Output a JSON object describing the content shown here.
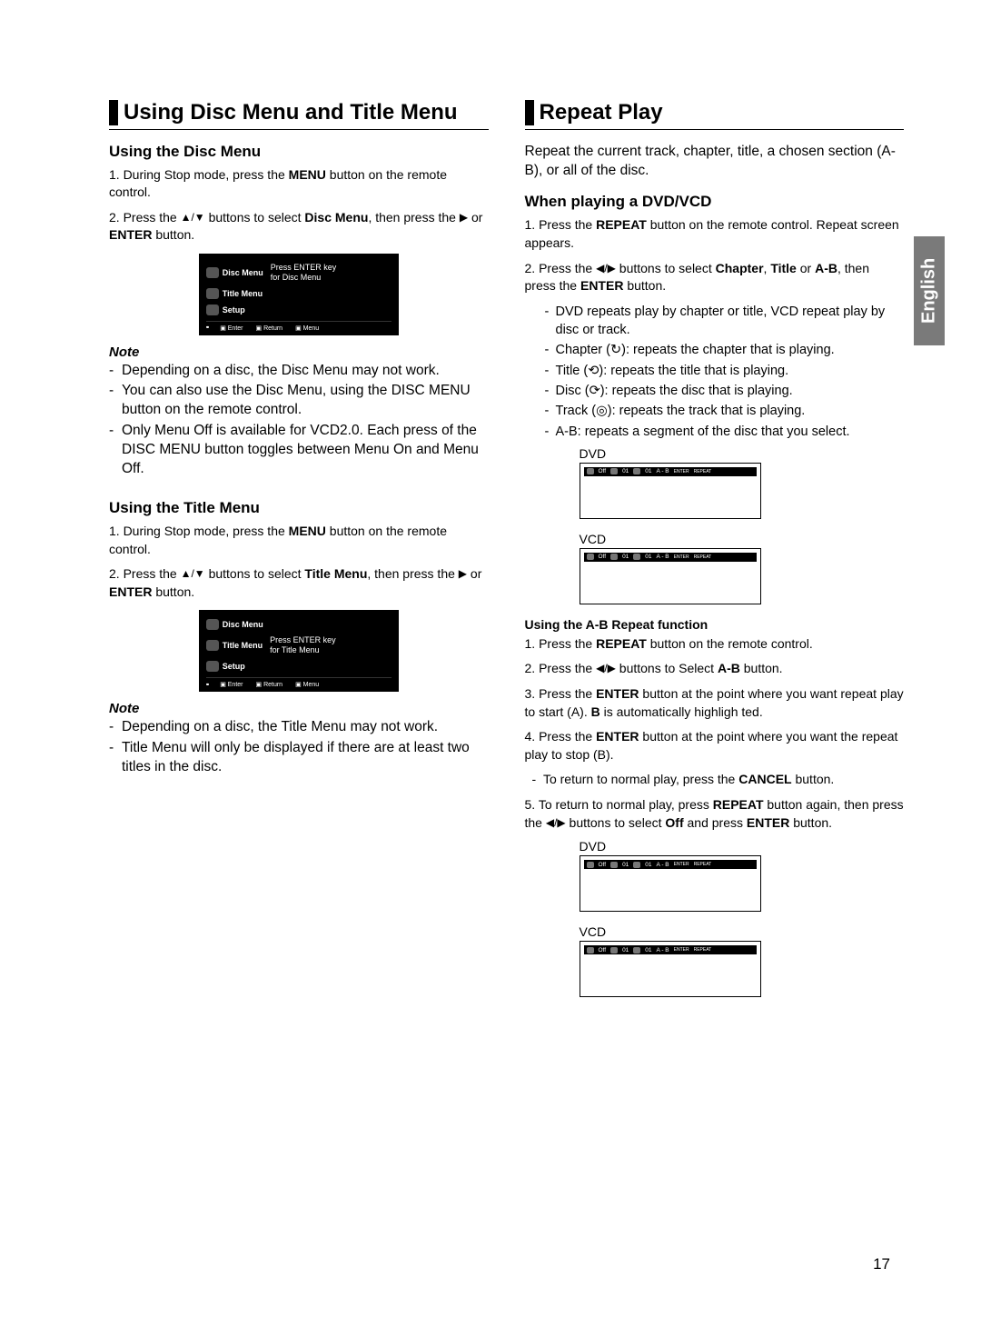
{
  "lang_tab": "English",
  "page_number": "17",
  "left": {
    "section_title": "Using Disc Menu and Title Menu",
    "disc": {
      "heading": "Using the Disc Menu",
      "step1_a": "1. During Stop mode, press the ",
      "step1_b": "MENU",
      "step1_c": " button on the remote control.",
      "step2_a": "2. Press the ",
      "step2_b": "▲/▼",
      "step2_c": " buttons to select ",
      "step2_d": "Disc Menu",
      "step2_e": ", then press the ",
      "step2_f": "▶",
      "step2_g": " or ",
      "step2_h": "ENTER",
      "step2_i": " button.",
      "osd": {
        "item1": "Disc Menu",
        "item2": "Title Menu",
        "item3": "Setup",
        "hint1": "Press ENTER key",
        "hint2": "for Disc Menu",
        "f1": "Enter",
        "f2": "Return",
        "f3": "Menu"
      },
      "note_label": "Note",
      "note1": "Depending on a disc, the Disc Menu may not work.",
      "note2": "You can also use the Disc Menu, using the DISC MENU button on the remote control.",
      "note3": "Only Menu Off is available for VCD2.0. Each press of the DISC MENU button toggles between Menu On and Menu Off."
    },
    "title": {
      "heading": "Using the Title Menu",
      "step1_a": "1. During Stop mode, press the ",
      "step1_b": "MENU",
      "step1_c": " button on the remote control.",
      "step2_a": "2. Press the ",
      "step2_b": "▲/▼",
      "step2_c": " buttons to select ",
      "step2_d": "Title Menu",
      "step2_e": ", then press the ",
      "step2_f": "▶",
      "step2_g": " or ",
      "step2_h": "ENTER",
      "step2_i": " button.",
      "osd": {
        "item1": "Disc Menu",
        "item2": "Title Menu",
        "item3": "Setup",
        "hint1": "Press ENTER key",
        "hint2": "for Title Menu",
        "f1": "Enter",
        "f2": "Return",
        "f3": "Menu"
      },
      "note_label": "Note",
      "note1": "Depending on a disc, the Title Menu may not work.",
      "note2": "Title Menu will only be displayed if there are at least two titles in the disc."
    }
  },
  "right": {
    "section_title": "Repeat Play",
    "intro": "Repeat the current track, chapter, title, a chosen section (A-B), or all of the disc.",
    "heading": "When playing a DVD/VCD",
    "step1_a": "1. Press the ",
    "step1_b": "REPEAT",
    "step1_c": " button on the remote control. Repeat screen appears.",
    "step2_a": "2. Press the ",
    "step2_b": "◀/▶",
    "step2_c": " buttons to select ",
    "step2_d": "Chapter",
    "step2_e": ", ",
    "step2_f": "Title",
    "step2_g": " or ",
    "step2_h": "A-B",
    "step2_i": ", then press the ",
    "step2_j": "ENTER",
    "step2_k": " button.",
    "sub1": "DVD repeats play by chapter or title, VCD repeat play by disc or track.",
    "sub2_a": "Chapter (",
    "sub2_b": "): repeats the chapter that is playing.",
    "sub3_a": "Title (",
    "sub3_b": "): repeats the title that is playing.",
    "sub4_a": "Disc (",
    "sub4_b": "): repeats the disc that is playing.",
    "sub5_a": "Track (",
    "sub5_b": "): repeats the track that is playing.",
    "sub6": "A-B: repeats a segment of the disc that you select.",
    "strip_dvd": "DVD",
    "strip_vcd": "VCD",
    "strip_off": "Off",
    "strip_01": "01",
    "strip_ab": "A - B",
    "strip_enter": "ENTER",
    "strip_repeat": "REPEAT",
    "ab_heading": "Using the A-B Repeat function",
    "ab1_a": "1. Press the ",
    "ab1_b": "REPEAT",
    "ab1_c": " button on the remote control.",
    "ab2_a": "2. Press the ",
    "ab2_b": "◀/▶",
    "ab2_c": " buttons to Select ",
    "ab2_d": "A-B",
    "ab2_e": " button.",
    "ab3_a": "3. Press the ",
    "ab3_b": "ENTER",
    "ab3_c": " button at the point where you want repeat play to start (A). ",
    "ab3_d": "B",
    "ab3_e": " is automatically highligh ted.",
    "ab4_a": "4. Press the ",
    "ab4_b": "ENTER",
    "ab4_c": " button at the point where you want the repeat play to stop (B).",
    "ab5_a": "To return to normal play, press the ",
    "ab5_b": "CANCEL",
    "ab5_c": " button.",
    "ab6_a": "5. To return to normal play, press ",
    "ab6_b": "REPEAT",
    "ab6_c": " button again, then press the ",
    "ab6_d": "◀/▶",
    "ab6_e": " buttons to select ",
    "ab6_f": "Off",
    "ab6_g": " and press ",
    "ab6_h": "ENTER",
    "ab6_i": " button."
  }
}
